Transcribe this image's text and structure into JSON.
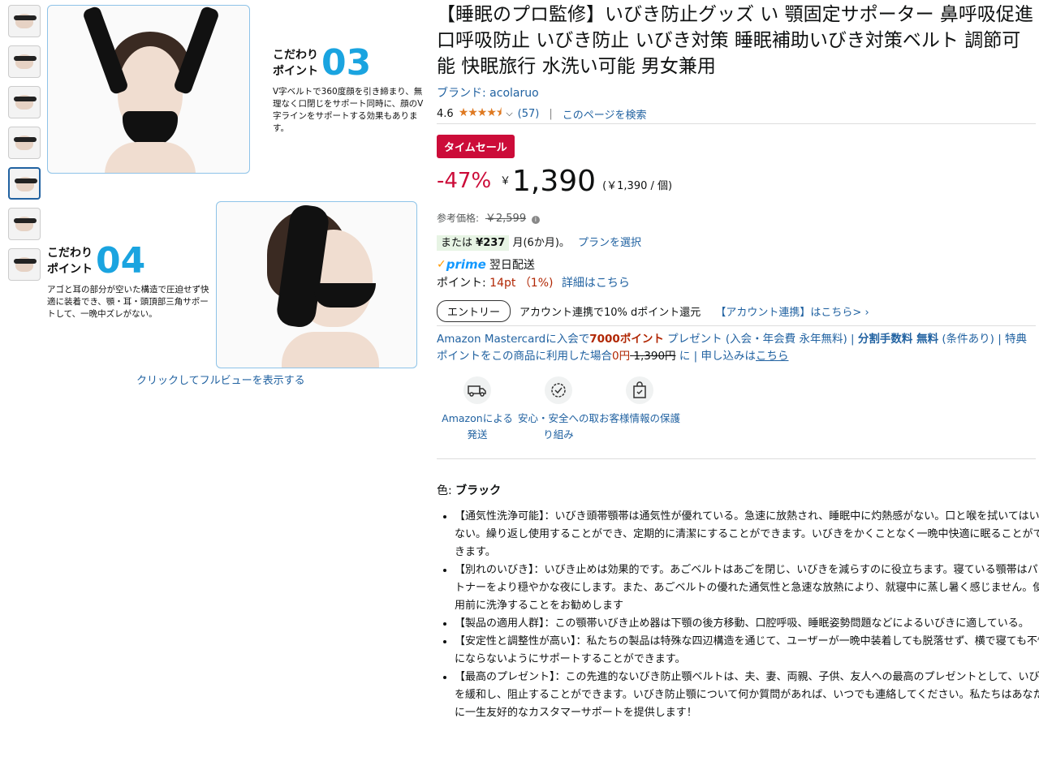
{
  "gallery": {
    "point3_label": "こだわり\nポイント",
    "point3_num": "03",
    "point3_desc": "V字ベルトで360度顔を引き締まり、無理なく口閉じをサポート同時に、顔のV字ラインをサポートする効果もあります。",
    "point4_label": "こだわり\nポイント",
    "point4_num": "04",
    "point4_desc": "アゴと耳の部分が空いた構造で圧迫せず快適に装着でき、顎・耳・頭頂部三角サポートして、一晩中ズレがない。",
    "fullview_link": "クリックしてフルビューを表示する"
  },
  "product": {
    "title": "【睡眠のプロ監修】いびき防止グッズ い 顎固定サポーター 鼻呼吸促進 口呼吸防止 いびき防止 いびき対策 睡眠補助いびき対策ベルト 調節可能 快眠旅行 水洗い可能 男女兼用",
    "brand": "ブランド: acolaruo",
    "rating": "4.6",
    "stars": "★★★★⯨",
    "review_count": "(57)",
    "separator": "|",
    "search_page": "このページを検索"
  },
  "pricing": {
    "sale_badge": "タイムセール",
    "discount": "-47%",
    "yen": "￥",
    "price": "1,390",
    "unit_price": "(￥1,390 / 個)",
    "ref_label": "参考価格:",
    "ref_price": "￥2,599",
    "installment_prefix": "または",
    "installment_amount": "¥237",
    "installment_suffix": "月(6か月)。",
    "installment_link": "プランを選択"
  },
  "delivery": {
    "prime": "prime",
    "prime_text": "翌日配送",
    "points_label": "ポイント:",
    "points_value": "14pt （1%)",
    "points_link": "詳細はこちら",
    "entry_button": "エントリー",
    "dpoint_text": "アカウント連携で10% dポイント還元",
    "dpoint_link": "【アカウント連携】はこちら> ›"
  },
  "card_offer": {
    "part1": "Amazon Mastercardに入会で",
    "points": "7000ポイント",
    "part2": " プレゼント (入会・年会費 永年無料) | ",
    "bold1": "分割手数料 無料",
    "part3": " (条件あり) | 特典ポイントをこの商品に利用した場合",
    "zero": "0円",
    "strike": " 1,390円",
    "part4": " に | 申し込みは",
    "here": "こちら"
  },
  "trust_icons": [
    {
      "label": "Amazonによる発送",
      "icon": "truck-icon"
    },
    {
      "label": "安心・安全への取り組み",
      "icon": "shield-badge-icon"
    },
    {
      "label": "お客様情報の保護",
      "icon": "bag-check-icon"
    }
  ],
  "color": {
    "label": "色:",
    "value": "ブラック"
  },
  "bullets": [
    "【通気性洗浄可能】：いびき頭帯顎帯は通気性が優れている。急速に放熱され、睡眠中に灼熱感がない。口と喉を拭いてはいけない。繰り返し使用することができ、定期的に清潔にすることができます。いびきをかくことなく一晩中快適に眠ることができます。",
    "【別れのいびき】：いびき止めは効果的です。あごベルトはあごを閉じ、いびきを減らすのに役立ちます。寝ている顎帯はパートナーをより穏やかな夜にします。また、あごベルトの優れた通気性と急速な放熱により、就寝中に蒸し暑く感じません。使用前に洗浄することをお勧めします",
    "【製品の適用人群】：この顎帯いびき止め器は下顎の後方移動、口腔呼吸、睡眠姿勢問題などによるいびきに適している。",
    "【安定性と調整性が高い】：私たちの製品は特殊な四辺構造を通じて、ユーザーが一晩中装着しても脱落せず、横で寝ても不快にならないようにサポートすることができます。",
    "【最高のプレゼント】：この先進的ないびき防止顎ベルトは、夫、妻、両親、子供、友人への最高のプレゼントとして、いびきを緩和し、阻止することができます。いびき防止顎について何か質問があれば、いつでも連絡してください。私たちはあなたに一生友好的なカスタマーサポートを提供します！"
  ]
}
